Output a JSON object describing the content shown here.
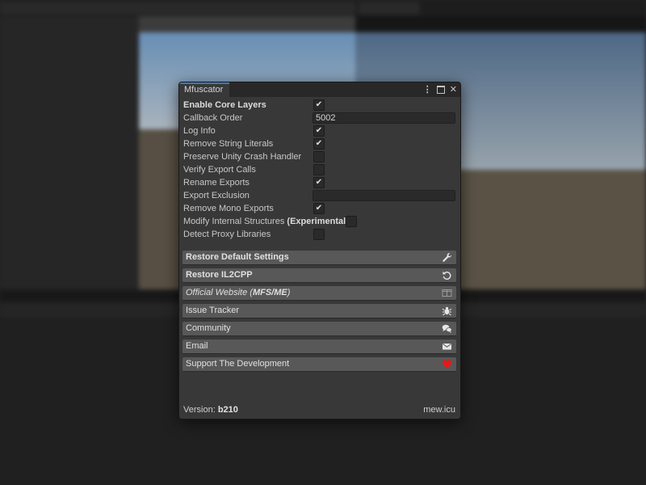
{
  "window": {
    "title": "Mfuscator",
    "controls": [
      "menu-icon",
      "maximize-icon",
      "close-icon"
    ]
  },
  "settings": [
    {
      "label": "Enable Core Layers",
      "type": "checkbox",
      "checked": true,
      "bold": true
    },
    {
      "label": "Callback Order",
      "type": "text",
      "value": "5002"
    },
    {
      "label": "Log Info",
      "type": "checkbox",
      "checked": true
    },
    {
      "label": "Remove String Literals",
      "type": "checkbox",
      "checked": true
    },
    {
      "label": "Preserve Unity Crash Handler",
      "type": "checkbox",
      "checked": false
    },
    {
      "label": "Verify Export Calls",
      "type": "checkbox",
      "checked": false
    },
    {
      "label": "Rename Exports",
      "type": "checkbox",
      "checked": true
    },
    {
      "label": "Export Exclusion",
      "type": "text",
      "value": ""
    },
    {
      "label": "Remove Mono Exports",
      "type": "checkbox",
      "checked": true
    },
    {
      "label": "Modify Internal Structures",
      "suffix": "(Experimental)",
      "type": "checkbox",
      "checked": false
    },
    {
      "label": "Detect Proxy Libraries",
      "type": "checkbox",
      "checked": false
    }
  ],
  "buttons": [
    {
      "label": "Restore Default Settings",
      "style": "bold",
      "icon": "wrench-icon"
    },
    {
      "label": "Restore IL2CPP",
      "style": "bold",
      "icon": "restore-icon"
    },
    {
      "label": "Official Website (",
      "label_bold": "MFS/ME",
      "label_end": ")",
      "style": "italic",
      "icon": "website-icon"
    },
    {
      "label": "Issue Tracker",
      "style": "normal",
      "icon": "bug-icon"
    },
    {
      "label": "Community",
      "style": "normal",
      "icon": "chat-icon"
    },
    {
      "label": "Email",
      "style": "normal",
      "icon": "email-icon"
    },
    {
      "label": "Support The Development",
      "style": "normal",
      "icon": "heart-icon",
      "icon_color": "#e01b1b"
    }
  ],
  "footer": {
    "version_label": "Version:",
    "version_value": "b210",
    "site": "mew.icu"
  },
  "checkmark_glyph": "✔"
}
